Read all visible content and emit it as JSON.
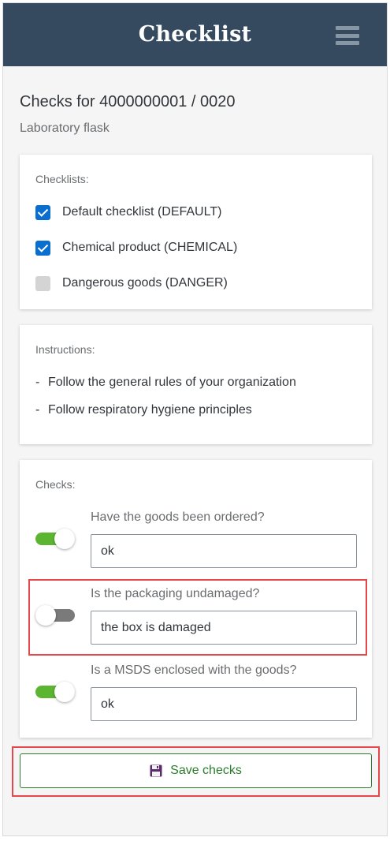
{
  "header": {
    "title": "Checklist",
    "menu_icon": "hamburger-menu-icon"
  },
  "page": {
    "title": "Checks for 4000000001 / 0020",
    "subtitle": "Laboratory flask"
  },
  "checklists": {
    "label": "Checklists:",
    "items": [
      {
        "label": "Default checklist (DEFAULT)",
        "checked": true
      },
      {
        "label": "Chemical product (CHEMICAL)",
        "checked": true
      },
      {
        "label": "Dangerous goods (DANGER)",
        "checked": false
      }
    ]
  },
  "instructions": {
    "label": "Instructions:",
    "items": [
      {
        "bullet": "-",
        "text": "Follow the general rules of your organization"
      },
      {
        "bullet": "-",
        "text": "Follow respiratory hygiene principles"
      }
    ]
  },
  "checks": {
    "label": "Checks:",
    "items": [
      {
        "question": "Have the goods been ordered?",
        "enabled": true,
        "value": "ok",
        "highlighted": false
      },
      {
        "question": "Is the packaging undamaged?",
        "enabled": false,
        "value": "the box is damaged",
        "highlighted": true
      },
      {
        "question": "Is a MSDS enclosed with the goods?",
        "enabled": true,
        "value": "ok",
        "highlighted": false
      }
    ]
  },
  "save_button": {
    "label": "Save checks",
    "icon": "floppy-disk-icon",
    "highlighted": true
  },
  "colors": {
    "header_bg": "#354a5f",
    "checkbox_checked": "#0a6ed1",
    "toggle_on": "#5cb531",
    "toggle_off": "#7a7a7a",
    "highlight": "#e5474b",
    "save_accent": "#2b7d2b"
  }
}
